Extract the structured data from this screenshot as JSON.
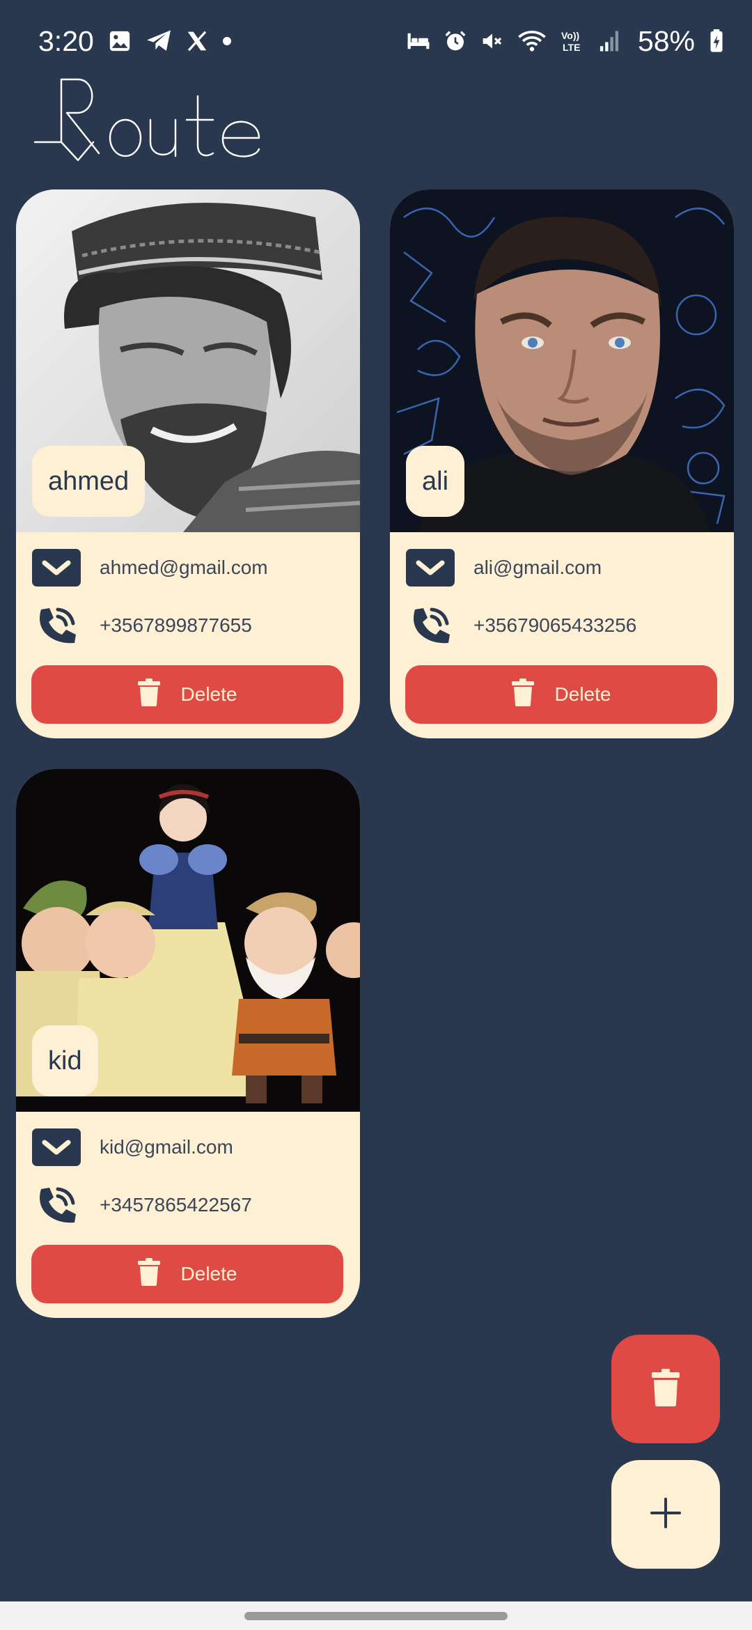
{
  "status_bar": {
    "time": "3:20",
    "battery": "58%",
    "left_icons": [
      "gallery-icon",
      "telegram-icon",
      "x-icon",
      "dot-icon"
    ],
    "right_icons": [
      "bed-icon",
      "alarm-icon",
      "mute-icon",
      "wifi-icon",
      "volte-icon",
      "signal-icon",
      "battery-icon"
    ],
    "volte_label": "Vo)) LTE"
  },
  "app": {
    "logo_text": "Route",
    "colors": {
      "background": "#29384e",
      "card": "#fdf0d5",
      "danger": "#df4a44"
    }
  },
  "contacts": [
    {
      "name": "ahmed",
      "email": "ahmed@gmail.com",
      "phone": "+3567899877655",
      "delete_label": "Delete"
    },
    {
      "name": "ali",
      "email": "ali@gmail.com",
      "phone": "+35679065433256",
      "delete_label": "Delete"
    },
    {
      "name": "kid",
      "email": "kid@gmail.com",
      "phone": "+3457865422567",
      "delete_label": "Delete"
    }
  ],
  "fabs": {
    "delete_icon": "trash-icon",
    "add_icon": "plus-icon"
  }
}
